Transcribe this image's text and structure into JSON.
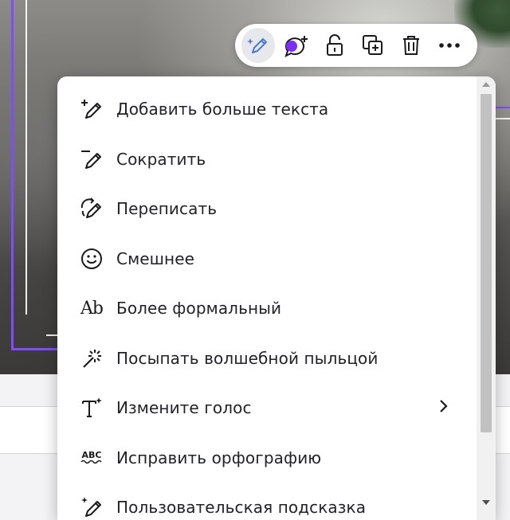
{
  "toolbar": {
    "buttons": [
      {
        "name": "magic-write-button",
        "icon": "magic-pen-icon",
        "active": true
      },
      {
        "name": "comment-button",
        "icon": "comment-add-icon"
      },
      {
        "name": "lock-button",
        "icon": "unlock-icon"
      },
      {
        "name": "duplicate-button",
        "icon": "duplicate-icon"
      },
      {
        "name": "delete-button",
        "icon": "trash-icon"
      },
      {
        "name": "more-button",
        "icon": "more-horizontal-icon"
      }
    ]
  },
  "menu": {
    "items": [
      {
        "label": "Добавить больше текста",
        "icon": "pen-plus-icon"
      },
      {
        "label": "Сократить",
        "icon": "pen-shorten-icon"
      },
      {
        "label": "Переписать",
        "icon": "pen-rewrite-icon"
      },
      {
        "label": "Смешнее",
        "icon": "smiley-icon"
      },
      {
        "label": "Более формальный",
        "icon": "ab-text-icon",
        "glyph": "Ab"
      },
      {
        "label": "Посыпать волшебной пыльцой",
        "icon": "magic-wand-icon"
      },
      {
        "label": "Измените голос",
        "icon": "text-voice-icon",
        "has_submenu": true
      },
      {
        "label": "Исправить орфографию",
        "icon": "spellcheck-icon",
        "glyph": "ABC"
      },
      {
        "label": "Пользовательская подсказка",
        "icon": "pen-sparkle-icon"
      }
    ]
  },
  "colors": {
    "accent": "#7d4dff",
    "magic_blue": "#4a7bd0"
  }
}
